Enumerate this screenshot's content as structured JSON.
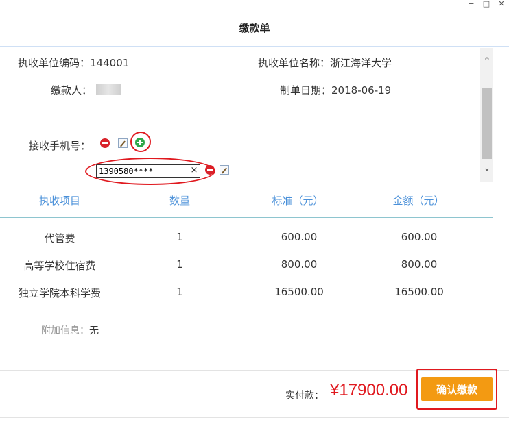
{
  "window": {
    "minimize": "−",
    "maximize": "□",
    "close": "✕"
  },
  "title": "缴款单",
  "info": {
    "unit_code_label": "执收单位编码：",
    "unit_code": "144001",
    "unit_name_label": "执收单位名称：",
    "unit_name": "浙江海洋大学",
    "payer_label": "缴款人：",
    "date_label": "制单日期：",
    "date": "2018-06-19",
    "phone_label": "接收手机号："
  },
  "phone_input": {
    "value": "1390580****",
    "clear": "×"
  },
  "table": {
    "headers": [
      "执收项目",
      "数量",
      "标准（元）",
      "金额（元）"
    ],
    "rows": [
      [
        "代管费",
        "1",
        "600.00",
        "600.00"
      ],
      [
        "高等学校住宿费",
        "1",
        "800.00",
        "800.00"
      ],
      [
        "独立学院本科学费",
        "1",
        "16500.00",
        "16500.00"
      ]
    ]
  },
  "extra": {
    "label": "附加信息：",
    "value": "无"
  },
  "footer": {
    "paid_label": "实付款：",
    "paid_amount": "¥17900.00",
    "confirm_label": "确认缴款",
    "amount_color": "#e0191f",
    "button_color": "#f39a12"
  },
  "scrollbar": {
    "up": "⌃",
    "down": "⌄"
  }
}
